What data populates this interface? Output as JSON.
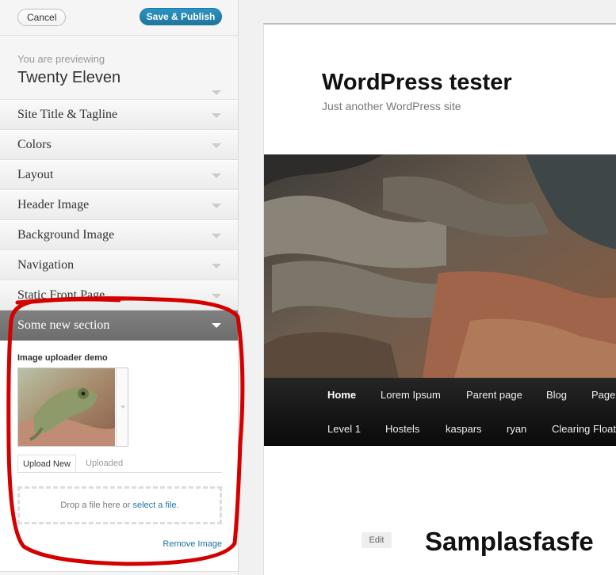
{
  "sidebar": {
    "cancel_label": "Cancel",
    "publish_label": "Save & Publish",
    "previewing_label": "You are previewing",
    "theme_name": "Twenty Eleven",
    "sections": [
      {
        "label": "Site Title & Tagline"
      },
      {
        "label": "Colors"
      },
      {
        "label": "Layout"
      },
      {
        "label": "Header Image"
      },
      {
        "label": "Background Image"
      },
      {
        "label": "Navigation"
      },
      {
        "label": "Static Front Page"
      }
    ],
    "open_section": {
      "label": "Some new section",
      "uploader_title": "Image uploader demo",
      "tabs": [
        "Upload New",
        "Uploaded"
      ],
      "drop_text": "Drop a file here or ",
      "select_link": "select a file",
      "drop_suffix": ".",
      "remove_label": "Remove Image"
    }
  },
  "preview": {
    "site_title": "WordPress tester",
    "tagline": "Just another WordPress site",
    "nav_row1": [
      "Home",
      "Lorem Ipsum",
      "Parent page",
      "Blog",
      "Page"
    ],
    "nav_row2": [
      "Level 1",
      "Hostels",
      "kaspars",
      "ryan",
      "Clearing Floats"
    ],
    "edit_label": "Edit",
    "post_title": "Samplasfasfe"
  },
  "colors": {
    "accent": "#21759b",
    "annotation": "#d40000"
  }
}
